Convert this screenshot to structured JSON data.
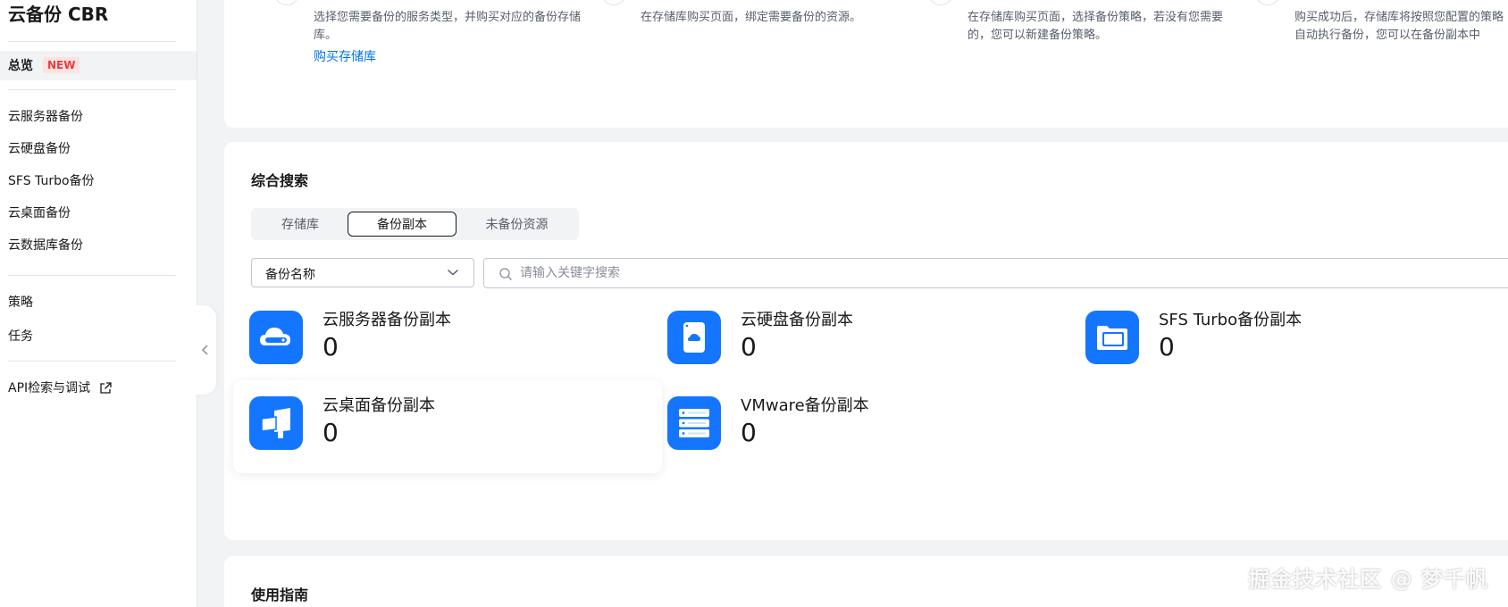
{
  "sidebar": {
    "brand": "云备份 CBR",
    "overview_label": "总览",
    "overview_badge": "NEW",
    "items": [
      {
        "label": "云服务器备份"
      },
      {
        "label": "云硬盘备份"
      },
      {
        "label": "SFS Turbo备份"
      },
      {
        "label": "云桌面备份"
      },
      {
        "label": "云数据库备份"
      }
    ],
    "policy_label": "策略",
    "task_label": "任务",
    "api_label": "API检索与调试"
  },
  "steps": [
    {
      "desc": "选择您需要备份的服务类型，并购买对应的备份存储库。",
      "link": "购买存储库"
    },
    {
      "desc": "在存储库购买页面，绑定需要备份的资源。"
    },
    {
      "desc": "在存储库购买页面，选择备份策略，若没有您需要的，您可以新建备份策略。"
    },
    {
      "desc": "购买成功后，存储库将按照您配置的策略自动执行备份，您可以在备份副本中"
    }
  ],
  "search": {
    "title": "综合搜索",
    "tabs": [
      "存储库",
      "备份副本",
      "未备份资源"
    ],
    "active_tab": "备份副本",
    "select_value": "备份名称",
    "placeholder": "请输入关键字搜索"
  },
  "stats": [
    {
      "name": "云服务器备份副本",
      "count": "0",
      "icon": "cloud-server-icon"
    },
    {
      "name": "云硬盘备份副本",
      "count": "0",
      "icon": "cloud-disk-icon"
    },
    {
      "name": "SFS Turbo备份副本",
      "count": "0",
      "icon": "folder-icon"
    },
    {
      "name": "云桌面备份副本",
      "count": "0",
      "icon": "cloud-desktop-icon"
    },
    {
      "name": "VMware备份副本",
      "count": "0",
      "icon": "server-rack-icon"
    }
  ],
  "guide": {
    "title": "使用指南"
  },
  "watermark": "掘金技术社区 @ 梦千帆",
  "colors": {
    "accent": "#1476ff",
    "link": "#0073e6",
    "badge_bg": "#fde2e2",
    "badge_text": "#e53e3e"
  }
}
